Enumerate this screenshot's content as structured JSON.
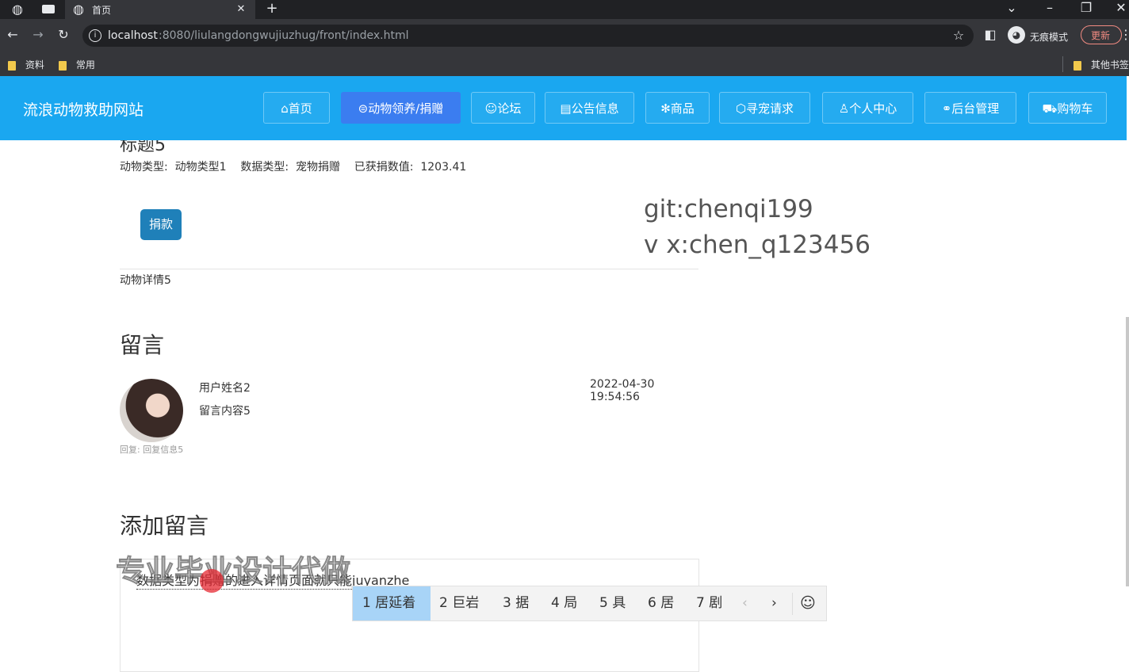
{
  "browser": {
    "tab_title": "首页",
    "url_host": "localhost",
    "url_rest": ":8080/liulangdongwujiuzhug/front/index.html",
    "profile_label": "无痕模式",
    "update_label": "更新",
    "bookmarks": [
      "资料",
      "常用"
    ],
    "other_bookmarks": "其他书签"
  },
  "site": {
    "title": "流浪动物救助网站",
    "nav": [
      {
        "label": "首页",
        "icon": "⌂"
      },
      {
        "label": "动物领养/捐赠",
        "icon": "⊜"
      },
      {
        "label": "论坛",
        "icon": "☺"
      },
      {
        "label": "公告信息",
        "icon": "▤"
      },
      {
        "label": "商品",
        "icon": "✻"
      },
      {
        "label": "寻宠请求",
        "icon": "⬡"
      },
      {
        "label": "个人中心",
        "icon": "♙"
      },
      {
        "label": "后台管理",
        "icon": "⚭"
      },
      {
        "label": "购物车",
        "icon": "⛟"
      }
    ]
  },
  "detail": {
    "title_partial": "标题5",
    "info": "动物类型:  动物类型1    数据类型:  宠物捐赠    已获捐数值:  1203.41",
    "donate_label": "捐款",
    "description": "动物详情5"
  },
  "watermark": {
    "line1": "git:chenqi199",
    "line2": "v x:chen_q123456",
    "ad_text": "专业毕业设计代做"
  },
  "comments": {
    "heading": "留言",
    "items": [
      {
        "user": "用户姓名2",
        "time": "2022-04-30 19:54:56",
        "content": "留言内容5",
        "reply": "回复:  回复信息5"
      }
    ]
  },
  "add_comment": {
    "heading": "添加留言",
    "input_text": "数据类型为捐赠的进入详情页面就只能juyanzhe"
  },
  "ime": {
    "candidates": [
      "1 居延着",
      "2 巨岩",
      "3 据",
      "4 局",
      "5 具",
      "6 居",
      "7 剧"
    ],
    "prev": "‹",
    "next": "›",
    "emoji": "☺"
  }
}
